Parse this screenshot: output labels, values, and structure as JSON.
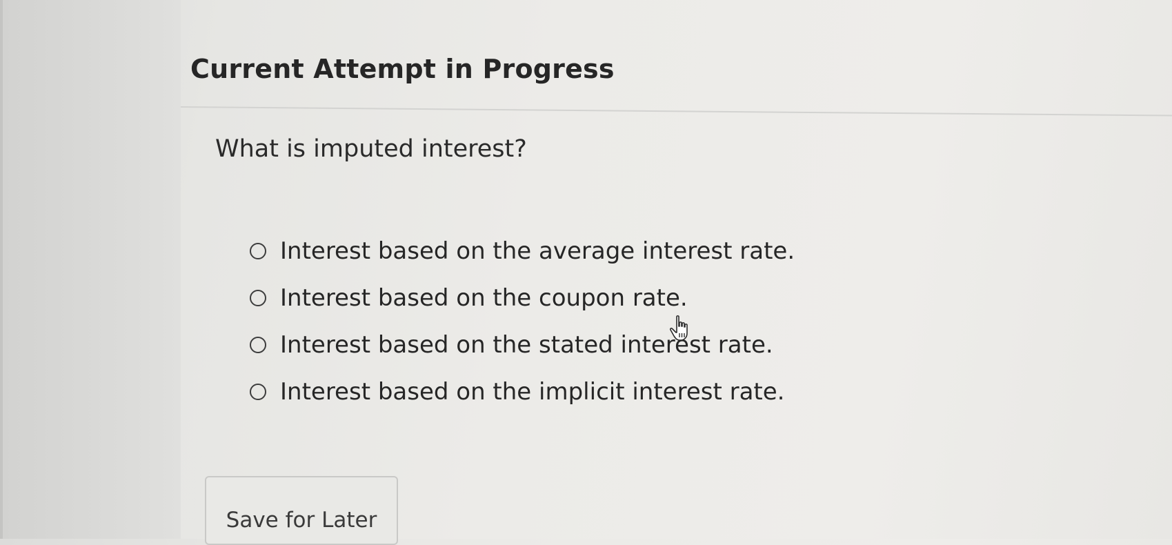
{
  "header": {
    "title": "Current Attempt in Progress"
  },
  "question": {
    "text": "What is imputed interest?",
    "options": [
      {
        "label": "Interest based on the average interest rate.",
        "selected": false
      },
      {
        "label": "Interest based on the coupon rate.",
        "selected": false
      },
      {
        "label": "Interest based on the stated interest rate.",
        "selected": false
      },
      {
        "label": "Interest based on the implicit interest rate.",
        "selected": false
      }
    ]
  },
  "actions": {
    "save_label": "Save for Later"
  },
  "cursor": {
    "icon": "hand-pointer-icon"
  },
  "colors": {
    "text": "#262626",
    "radio_border": "#3c3c3c",
    "button_border": "#c9c9c7"
  }
}
